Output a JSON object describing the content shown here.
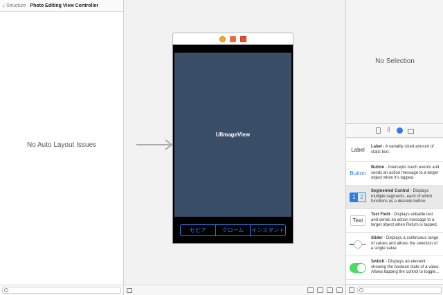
{
  "outline": {
    "back_label": "Structure",
    "title": "Photo Editing View Controller",
    "empty_message": "No Auto Layout Issues"
  },
  "canvas": {
    "image_view_label": "UIImageView",
    "segments": [
      "セピア",
      "クローム",
      "インスタント"
    ]
  },
  "inspector": {
    "empty_message": "No Selection"
  },
  "library": {
    "tab_icons": [
      "file-template-icon",
      "code-snippet-icon",
      "object-library-icon",
      "media-library-icon"
    ],
    "items": [
      {
        "thumb": "Label",
        "name": "Label",
        "desc": " - A variably sized amount of static text."
      },
      {
        "thumb": "Button",
        "name": "Button",
        "desc": " - Intercepts touch events and sends an action message to a target object when it's tapped."
      },
      {
        "thumb_1": "1",
        "thumb_2": "2",
        "name": "Segmented Control",
        "desc": " - Displays multiple segments, each of which functions as a discrete button."
      },
      {
        "thumb": "Text",
        "name": "Text Field",
        "desc": " - Displays editable text and sends an action message to a target object when Return is tapped."
      },
      {
        "name": "Slider",
        "desc": " - Displays a continuous range of values and allows the selection of a single value."
      },
      {
        "name": "Switch",
        "desc": " - Displays an element showing the boolean state of a value. Allows tapping the control to toggle..."
      }
    ]
  },
  "colors": {
    "accent": "#2e7ce4",
    "image_view_bg": "#3b4e67",
    "switch_on": "#4cd964"
  }
}
